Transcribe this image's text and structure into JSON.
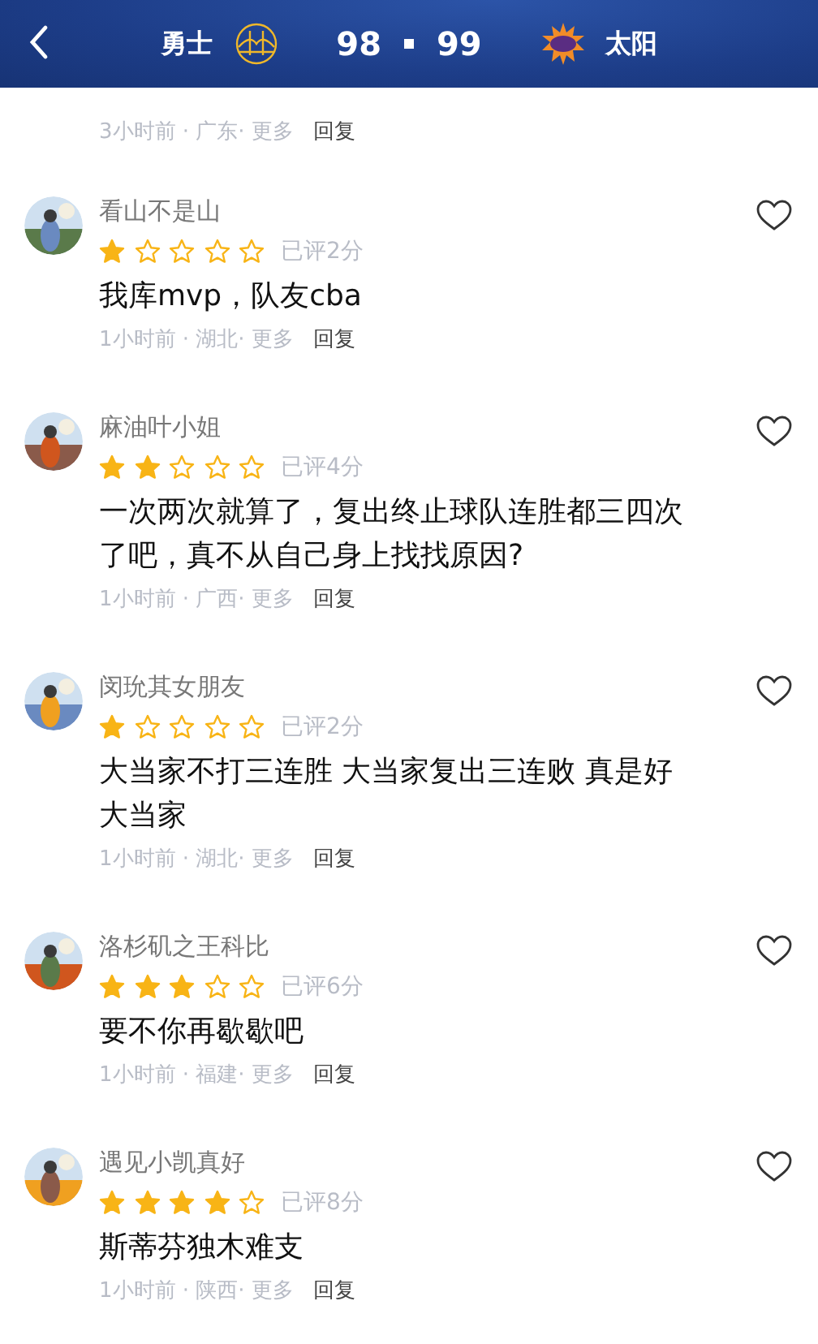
{
  "header": {
    "home_team": "勇士",
    "home_score": "98",
    "away_score": "99",
    "away_team": "太阳"
  },
  "previous_comment": {
    "meta": "3小时前 · 广东· 更多",
    "reply": "回复"
  },
  "comments": [
    {
      "name": "看山不是山",
      "stars": 1,
      "score": "已评2分",
      "body": "我库mvp，队友cba",
      "meta": "1小时前 · 湖北· 更多",
      "reply": "回复"
    },
    {
      "name": "麻油叶小姐",
      "stars": 2,
      "score": "已评4分",
      "body": "一次两次就算了，复出终止球队连胜都三四次了吧，真不从自己身上找找原因?",
      "meta": "1小时前 · 广西· 更多",
      "reply": "回复"
    },
    {
      "name": "闵玧其女朋友",
      "stars": 1,
      "score": "已评2分",
      "body": "大当家不打三连胜 大当家复出三连败 真是好大当家",
      "meta": "1小时前 · 湖北· 更多",
      "reply": "回复"
    },
    {
      "name": "洛杉矶之王科比",
      "stars": 3,
      "score": "已评6分",
      "body": "要不你再歇歇吧",
      "meta": "1小时前 · 福建· 更多",
      "reply": "回复"
    },
    {
      "name": "遇见小凯真好",
      "stars": 4,
      "score": "已评8分",
      "body": "斯蒂芬独木难支",
      "meta": "1小时前 · 陕西· 更多",
      "reply": "回复"
    }
  ]
}
